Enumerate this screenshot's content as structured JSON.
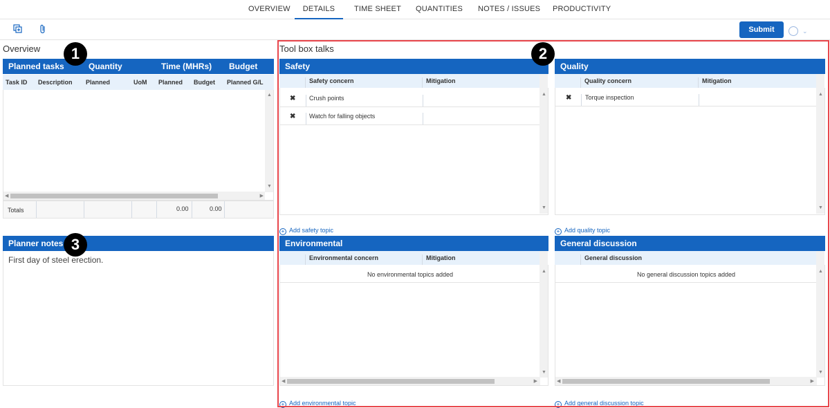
{
  "tabs": [
    "OVERVIEW",
    "DETAILS",
    "TIME SHEET",
    "QUANTITIES",
    "NOTES / ISSUES",
    "PRODUCTIVITY"
  ],
  "toolbar": {
    "copy_icon": "copy-add-icon",
    "attach_icon": "paperclip-icon",
    "submit_label": "Submit"
  },
  "overview": {
    "title": "Overview",
    "group_headers": [
      "Planned tasks",
      "Quantity",
      "Time (MHRs)",
      "Budget"
    ],
    "columns": [
      "Task ID",
      "Description",
      "Planned",
      "UoM",
      "Planned",
      "Budget",
      "Planned G/L"
    ],
    "totals_label": "Totals",
    "totals_time_planned": "0.00",
    "totals_time_budget": "0.00"
  },
  "planner_notes": {
    "title": "Planner notes",
    "text": "First day of steel erection."
  },
  "toolbox": {
    "title": "Tool box talks",
    "safety": {
      "title": "Safety",
      "concern_header": "Safety concern",
      "mitigation_header": "Mitigation",
      "rows": [
        {
          "mark": "✖",
          "concern": "Crush points",
          "mitigation": ""
        },
        {
          "mark": "✖",
          "concern": "Watch for falling objects",
          "mitigation": ""
        }
      ],
      "add_label": "Add safety topic"
    },
    "quality": {
      "title": "Quality",
      "concern_header": "Quality concern",
      "mitigation_header": "Mitigation",
      "rows": [
        {
          "mark": "✖",
          "concern": "Torque inspection",
          "mitigation": ""
        }
      ],
      "add_label": "Add quality topic"
    },
    "environmental": {
      "title": "Environmental",
      "concern_header": "Environmental concern",
      "mitigation_header": "Mitigation",
      "empty": "No environmental topics added",
      "add_label": "Add environmental topic"
    },
    "general": {
      "title": "General discussion",
      "concern_header": "General discussion",
      "empty": "No general discussion topics added",
      "add_label": "Add general discussion topic"
    }
  },
  "callouts": [
    "1",
    "2",
    "3"
  ],
  "colors": {
    "accent": "#1565c0",
    "subheader": "#e7f1fb",
    "highlight_border": "#e8454b"
  }
}
